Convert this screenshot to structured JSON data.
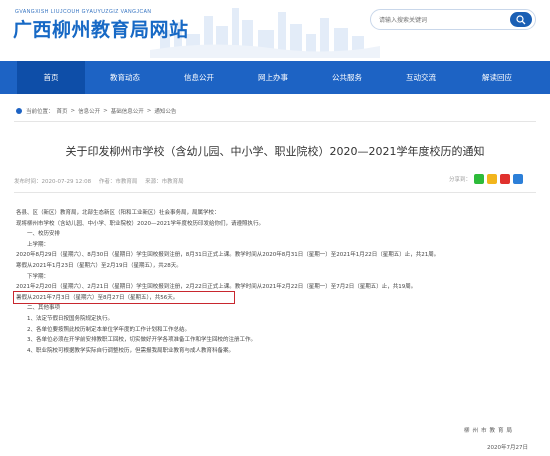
{
  "header": {
    "subtitle": "GVANGXISH LIUJCOUH GYAUYUZGIZ VANGJCAN",
    "title": "广西柳州教育局网站",
    "search_placeholder": "请输入搜索关键词"
  },
  "nav": {
    "items": [
      "首页",
      "教育动态",
      "信息公开",
      "网上办事",
      "公共服务",
      "互动交流",
      "解读回应"
    ]
  },
  "breadcrumb": {
    "prefix": "当前位置：",
    "items": [
      "首页",
      "信息公开",
      "基础信息公开",
      "通知公告"
    ],
    "separator": ">"
  },
  "article": {
    "title": "关于印发柳州市学校（含幼儿园、中小学、职业院校）2020—2021学年度校历的通知",
    "publish_time": "发布时间：2020-07-29 12:08",
    "author": "作者：市教育局",
    "source": "来源：市教育局",
    "share_label": "分享到：",
    "lines": [
      "各县、区（新区）教育局，北部生态新区（阳和工业新区）社会事务局，局属学校：",
      "现将柳州市学校（含幼儿园、中小学、职业院校）2020—2021学年度校历印发给你们，请遵照执行。",
      "一、校历安排",
      "上学期：",
      "2020年8月29日（星期六）、8月30日（星期日）学生回校报到注册，8月31日正式上课。教学时间从2020年8月31日（星期一）至2021年1月22日（星期五）止，共21周。",
      "寒假从2021年1月23日（星期六）至2月19日（星期五），共28天。",
      "下学期：",
      "2021年2月20日（星期六）、2月21日（星期日）学生回校报到注册，2月22日正式上课。教学时间从2021年2月22日（星期一）至7月2日（星期五）止，共19周。",
      "暑假从2021年7月3日（星期六）至8月27日（星期五），共56天。",
      "二、其他事项",
      "1、法定节假日按国务院规定执行。",
      "2、各单位要按照此校历制定本单位学年度的工作计划和工作总结。",
      "3、各单位必须在开学前安排教职工回校，切实做好开学各项准备工作和学生回校的注册工作。",
      "4、职业院校可根据教学实际自行调整校历，但需报我局职业教育与成人教育科备案。"
    ],
    "signature": "柳州市教育局",
    "date": "2020年7月27日"
  },
  "colors": {
    "brand_blue": "#1d63c4",
    "nav_active": "#0e4ea8",
    "highlight_border": "#c8272e"
  }
}
